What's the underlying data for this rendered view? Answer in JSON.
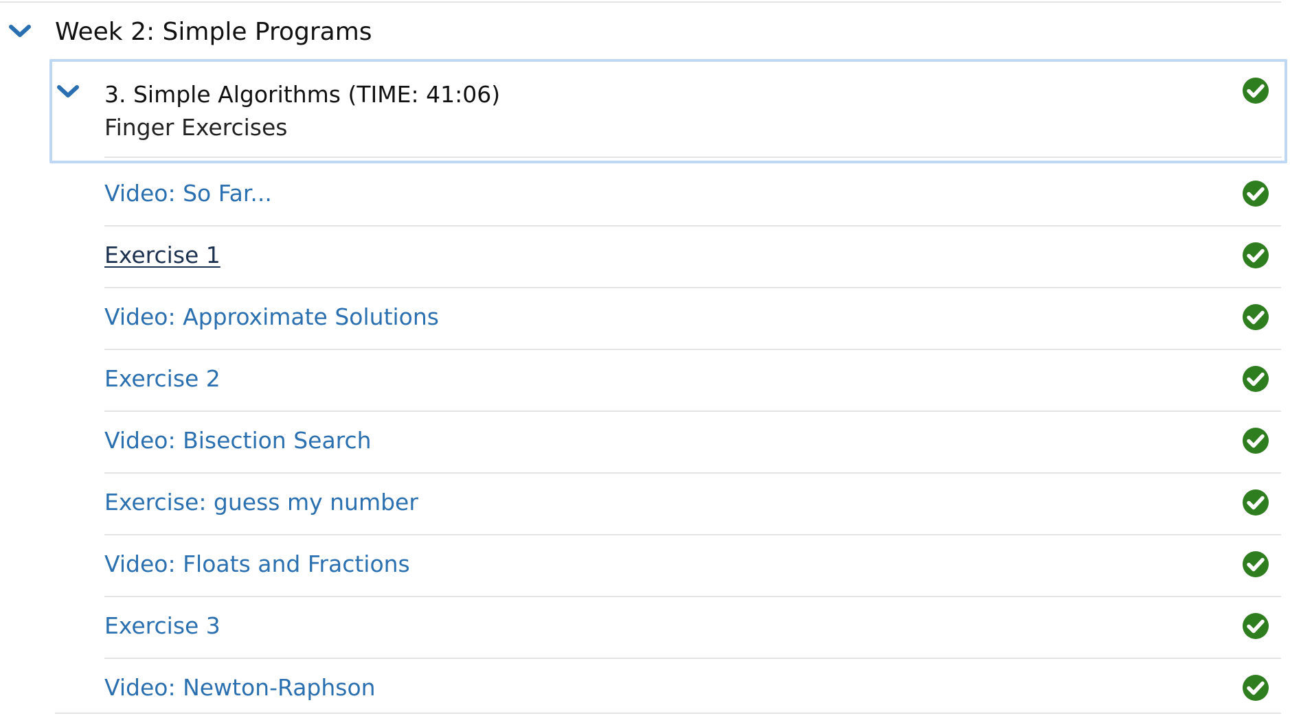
{
  "week": {
    "title": "Week 2: Simple Programs",
    "expand_icon": "chevron-down-icon"
  },
  "subsection": {
    "title": "3. Simple Algorithms (TIME: 41:06)",
    "subtitle": "Finger Exercises",
    "expand_icon": "chevron-down-icon",
    "status_icon": "check-circle-icon",
    "completed": true
  },
  "items": [
    {
      "label": "Video: So Far...",
      "status_icon": "check-circle-icon",
      "completed": true,
      "visited": false
    },
    {
      "label": "Exercise 1",
      "status_icon": "check-circle-icon",
      "completed": true,
      "visited": true
    },
    {
      "label": "Video: Approximate Solutions",
      "status_icon": "check-circle-icon",
      "completed": true,
      "visited": false
    },
    {
      "label": "Exercise 2",
      "status_icon": "check-circle-icon",
      "completed": true,
      "visited": false
    },
    {
      "label": "Video: Bisection Search",
      "status_icon": "check-circle-icon",
      "completed": true,
      "visited": false
    },
    {
      "label": "Exercise: guess my number",
      "status_icon": "check-circle-icon",
      "completed": true,
      "visited": false
    },
    {
      "label": "Video: Floats and Fractions",
      "status_icon": "check-circle-icon",
      "completed": true,
      "visited": false
    },
    {
      "label": "Exercise 3",
      "status_icon": "check-circle-icon",
      "completed": true,
      "visited": false
    },
    {
      "label": "Video: Newton-Raphson",
      "status_icon": "check-circle-icon",
      "completed": true,
      "visited": false
    }
  ],
  "colors": {
    "link": "#2a6faf",
    "link_visited": "#1c3150",
    "chevron": "#2a6faf",
    "check": "#2e7d1e",
    "focus_border": "#bed8f4",
    "divider": "#e3e3e3"
  }
}
